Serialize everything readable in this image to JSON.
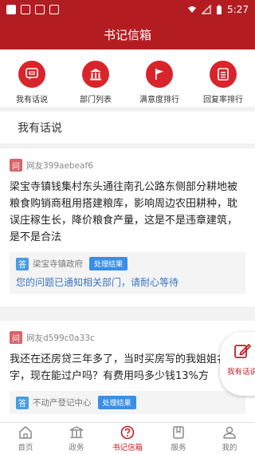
{
  "status_bar": {
    "time": "5:27"
  },
  "header": {
    "title": "书记信箱"
  },
  "quick_nav": [
    {
      "label": "我有话说",
      "icon": "speech-icon"
    },
    {
      "label": "部门列表",
      "icon": "building-icon"
    },
    {
      "label": "满意度排行",
      "icon": "flag-icon"
    },
    {
      "label": "回复率排行",
      "icon": "list-icon"
    }
  ],
  "section": {
    "title": "我有话说"
  },
  "posts": [
    {
      "q_badge": "问",
      "user": "网友399aebeaf6",
      "content": "梁宝寺镇钱集村东头通往南孔公路东侧部分耕地被粮食购销商租用搭建粮库，影响周边农田耕种，耽误庄稼生长，降价粮食产量，这是不是违章建筑，是不是合法",
      "reply": {
        "a_badge": "答",
        "dept": "梁宝寺镇政府",
        "status": "处理结果",
        "text": "您的问题已通知相关部门，请耐心等待"
      }
    },
    {
      "q_badge": "问",
      "user": "网友d599c0a33c",
      "content": "我还在还房贷三年多了，当时买房写的我姐姐名字，现在能过户吗？有费用吗多少钱13%方",
      "reply": {
        "a_badge": "答",
        "dept": "不动产登记中心",
        "status": "处理结果"
      }
    }
  ],
  "fab": {
    "label": "我有话说",
    "icon": "edit-icon"
  },
  "bottom_nav": [
    {
      "label": "首页",
      "icon": "home-icon"
    },
    {
      "label": "政务",
      "icon": "government-icon"
    },
    {
      "label": "书记信箱",
      "icon": "question-icon",
      "active": true
    },
    {
      "label": "服务",
      "icon": "bookmark-icon"
    },
    {
      "label": "我的",
      "icon": "user-icon"
    }
  ],
  "colors": {
    "brand": "#b31d22",
    "accent": "#d8252b",
    "reply_blue": "#3a74c0"
  }
}
